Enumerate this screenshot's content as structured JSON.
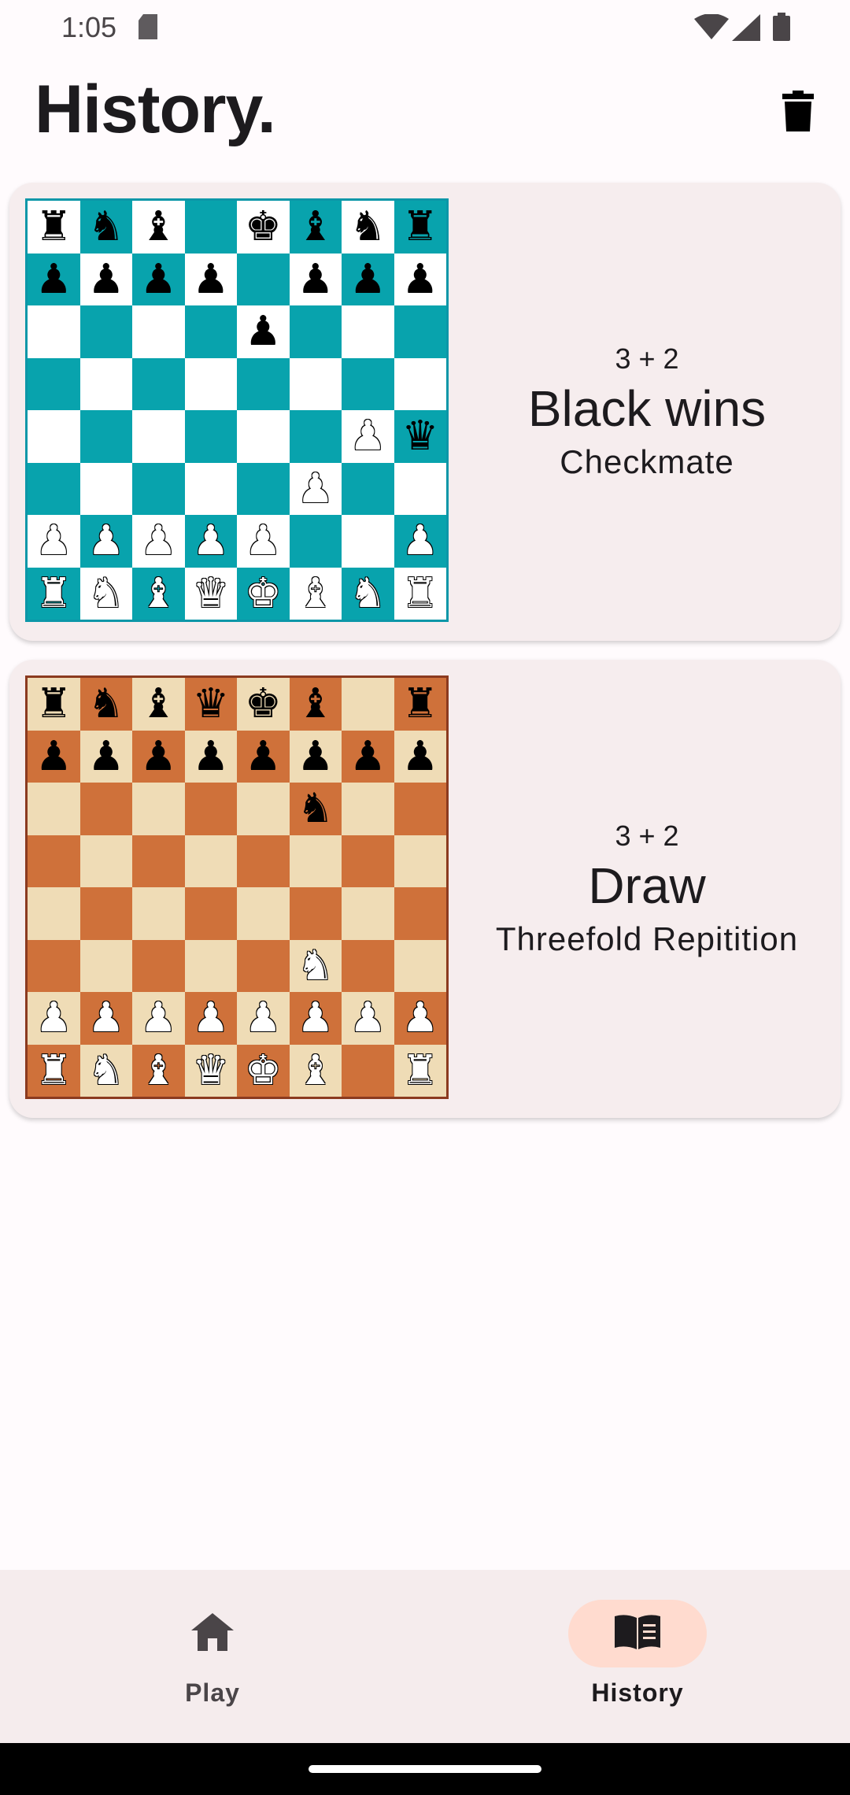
{
  "status_bar": {
    "time": "1:05",
    "icons": [
      "sd-card-icon",
      "wifi-icon",
      "signal-icon",
      "battery-icon"
    ]
  },
  "header": {
    "title": "History.",
    "delete_icon": "trash-icon"
  },
  "games": [
    {
      "time_control": "3 + 2",
      "result": "Black wins",
      "reason": "Checkmate",
      "board_theme": "blue",
      "colors": {
        "light": "#ffffff",
        "dark": "#08a3ad",
        "border": "#0c97a8"
      },
      "position": [
        [
          "br",
          "bn",
          "bb",
          "",
          "bk",
          "bb",
          "bn",
          "br"
        ],
        [
          "bp",
          "bp",
          "bp",
          "bp",
          "",
          "bp",
          "bp",
          "bp"
        ],
        [
          "",
          "",
          "",
          "",
          "bp",
          "",
          "",
          ""
        ],
        [
          "",
          "",
          "",
          "",
          "",
          "",
          "",
          ""
        ],
        [
          "",
          "",
          "",
          "",
          "",
          "",
          "wp",
          "bq"
        ],
        [
          "",
          "",
          "",
          "",
          "",
          "wp",
          "",
          ""
        ],
        [
          "wp",
          "wp",
          "wp",
          "wp",
          "wp",
          "",
          "",
          "wp"
        ],
        [
          "wr",
          "wn",
          "wb",
          "wq",
          "wk",
          "wb",
          "wn",
          "wr"
        ]
      ]
    },
    {
      "time_control": "3 + 2",
      "result": "Draw",
      "reason": "Threefold Repitition",
      "board_theme": "brown",
      "colors": {
        "light": "#efdcb6",
        "dark": "#cf713a",
        "border": "#8b3a1f"
      },
      "position": [
        [
          "br",
          "bn",
          "bb",
          "bq",
          "bk",
          "bb",
          "",
          "br"
        ],
        [
          "bp",
          "bp",
          "bp",
          "bp",
          "bp",
          "bp",
          "bp",
          "bp"
        ],
        [
          "",
          "",
          "",
          "",
          "",
          "bn",
          "",
          ""
        ],
        [
          "",
          "",
          "",
          "",
          "",
          "",
          "",
          ""
        ],
        [
          "",
          "",
          "",
          "",
          "",
          "",
          "",
          ""
        ],
        [
          "",
          "",
          "",
          "",
          "",
          "wn",
          "",
          ""
        ],
        [
          "wp",
          "wp",
          "wp",
          "wp",
          "wp",
          "wp",
          "wp",
          "wp"
        ],
        [
          "wr",
          "wn",
          "wb",
          "wq",
          "wk",
          "wb",
          "",
          "wr"
        ]
      ]
    }
  ],
  "bottom_nav": {
    "items": [
      {
        "label": "Play",
        "icon": "home-icon",
        "active": false
      },
      {
        "label": "History",
        "icon": "book-icon",
        "active": true
      }
    ],
    "active_color": "#ffdbcf"
  }
}
